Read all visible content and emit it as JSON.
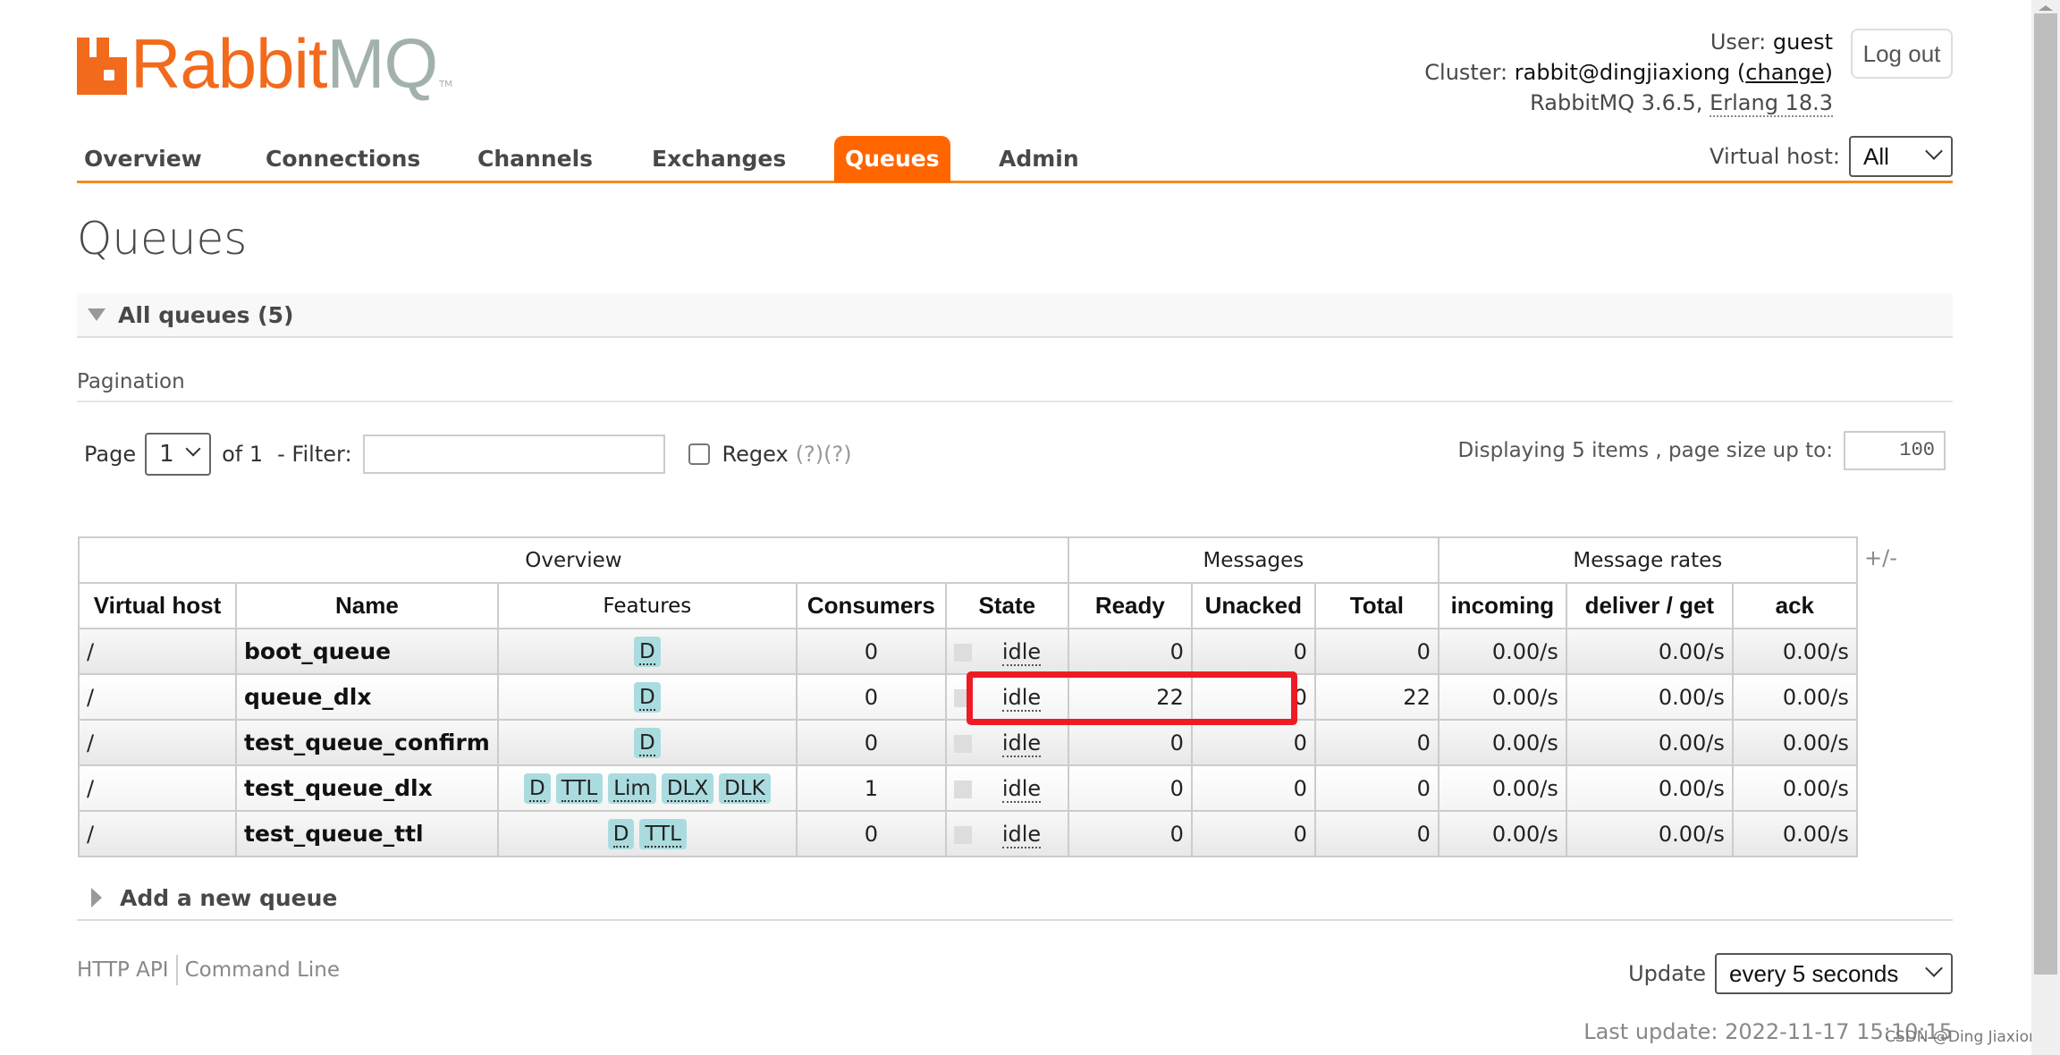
{
  "app": {
    "logo_rabbit": "Rabbit",
    "logo_mq": "MQ",
    "logo_tm": "TM"
  },
  "login": {
    "user_label": "User:",
    "user": "guest",
    "cluster_label": "Cluster:",
    "cluster": "rabbit@dingjiaxiong",
    "change_link": "change",
    "version": "RabbitMQ 3.6.5,",
    "erlang": "Erlang 18.3",
    "logout_label": "Log out"
  },
  "tabs": [
    {
      "label": "Overview",
      "active": false
    },
    {
      "label": "Connections",
      "active": false
    },
    {
      "label": "Channels",
      "active": false
    },
    {
      "label": "Exchanges",
      "active": false
    },
    {
      "label": "Queues",
      "active": true
    },
    {
      "label": "Admin",
      "active": false
    }
  ],
  "vhost": {
    "label": "Virtual host:",
    "selected": "All"
  },
  "page_title": "Queues",
  "all_queues": {
    "title": "All queues (5)"
  },
  "pagination": {
    "title": "Pagination",
    "page_label": "Page",
    "page_selected": "1",
    "of_label": "of 1",
    "filter_label": "- Filter:",
    "filter_value": "",
    "regex_label": "Regex",
    "regex_checked": false,
    "help1": "(?)",
    "help2": "(?)",
    "displaying": "Displaying 5 items , page size up to:",
    "page_size": "100"
  },
  "table": {
    "groups": [
      "Overview",
      "Messages",
      "Message rates"
    ],
    "columns": [
      "Virtual host",
      "Name",
      "Features",
      "Consumers",
      "State",
      "Ready",
      "Unacked",
      "Total",
      "incoming",
      "deliver / get",
      "ack"
    ],
    "toggle_columns": "+/-",
    "rows": [
      {
        "vhost": "/",
        "name": "boot_queue",
        "features": [
          "D"
        ],
        "consumers": "0",
        "state": "idle",
        "ready": "0",
        "unacked": "0",
        "total": "0",
        "incoming": "0.00/s",
        "deliver_get": "0.00/s",
        "ack": "0.00/s"
      },
      {
        "vhost": "/",
        "name": "queue_dlx",
        "features": [
          "D"
        ],
        "consumers": "0",
        "state": "idle",
        "ready": "22",
        "unacked": "0",
        "total": "22",
        "incoming": "0.00/s",
        "deliver_get": "0.00/s",
        "ack": "0.00/s"
      },
      {
        "vhost": "/",
        "name": "test_queue_confirm",
        "features": [
          "D"
        ],
        "consumers": "0",
        "state": "idle",
        "ready": "0",
        "unacked": "0",
        "total": "0",
        "incoming": "0.00/s",
        "deliver_get": "0.00/s",
        "ack": "0.00/s"
      },
      {
        "vhost": "/",
        "name": "test_queue_dlx",
        "features": [
          "D",
          "TTL",
          "Lim",
          "DLX",
          "DLK"
        ],
        "consumers": "1",
        "state": "idle",
        "ready": "0",
        "unacked": "0",
        "total": "0",
        "incoming": "0.00/s",
        "deliver_get": "0.00/s",
        "ack": "0.00/s"
      },
      {
        "vhost": "/",
        "name": "test_queue_ttl",
        "features": [
          "D",
          "TTL"
        ],
        "consumers": "0",
        "state": "idle",
        "ready": "0",
        "unacked": "0",
        "total": "0",
        "incoming": "0.00/s",
        "deliver_get": "0.00/s",
        "ack": "0.00/s"
      }
    ]
  },
  "add_queue": {
    "title": "Add a new queue"
  },
  "footer": {
    "http_api": "HTTP API",
    "command_line": "Command Line",
    "update_label": "Update",
    "update_selected": "every 5 seconds",
    "last_update": "Last update: 2022-11-17 15:10:15"
  },
  "watermark": "CSDN @Ding Jiaxiong",
  "colors": {
    "brand_orange": "#ff6600",
    "tab_underline": "#f68b1f",
    "badge": "#aadcdf",
    "highlight": "#ed1c24"
  }
}
